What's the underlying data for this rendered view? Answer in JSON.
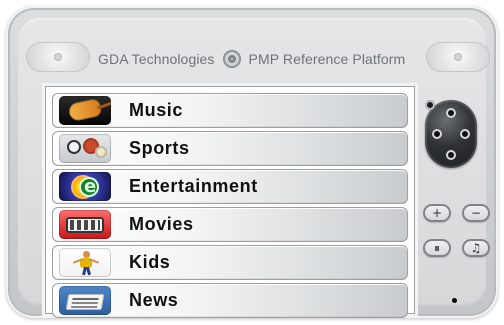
{
  "header": {
    "brand_left": "GDA Technologies",
    "brand_right": "PMP Reference Platform"
  },
  "menu": {
    "items": [
      {
        "label": "Music",
        "icon": "music-thumb"
      },
      {
        "label": "Sports",
        "icon": "sports-thumb"
      },
      {
        "label": "Entertainment",
        "icon": "entertainment-thumb"
      },
      {
        "label": "Movies",
        "icon": "movies-thumb"
      },
      {
        "label": "Kids",
        "icon": "kids-thumb"
      },
      {
        "label": "News",
        "icon": "news-thumb"
      }
    ]
  },
  "controls": {
    "buttons": {
      "plus_glyph": "+",
      "minus_glyph": "−",
      "pause_glyph": "⏸",
      "music_glyph": "♫"
    }
  }
}
